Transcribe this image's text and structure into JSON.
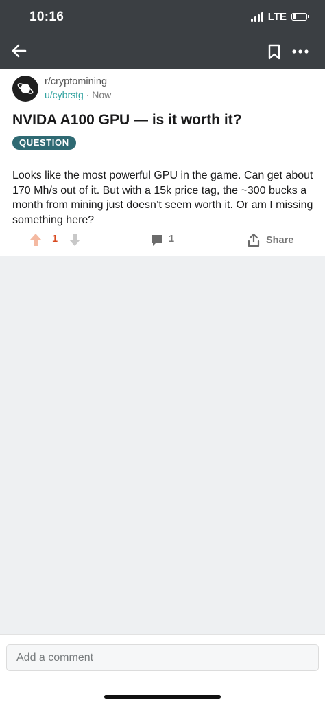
{
  "status_bar": {
    "time": "10:16",
    "network": "LTE"
  },
  "toolbar": {
    "back_icon": "arrow-left-icon",
    "bookmark_icon": "bookmark-icon",
    "more_icon": "more-horizontal-icon"
  },
  "post": {
    "subreddit": "r/cryptomining",
    "author": "u/cybrstg",
    "separator": "·",
    "timestamp": "Now",
    "title": "NVIDA A100 GPU — is it worth it?",
    "flair": "QUESTION",
    "body": "Looks like the most powerful GPU in the game. Can get about 170 Mh/s out of it. But with a 15k price tag, the ~300 bucks a month from mining just doesn’t seem worth it. Or am I missing something here?",
    "score": "1",
    "comment_count": "1",
    "share_label": "Share"
  },
  "comment_box": {
    "placeholder": "Add a comment"
  },
  "colors": {
    "top_bar": "#3b3f43",
    "flair_bg": "#2f6a73",
    "author_link": "#32a3a0",
    "score": "#d84a20",
    "upvote_arrow": "#f4b9a1",
    "page_bg": "#eef0f2"
  }
}
